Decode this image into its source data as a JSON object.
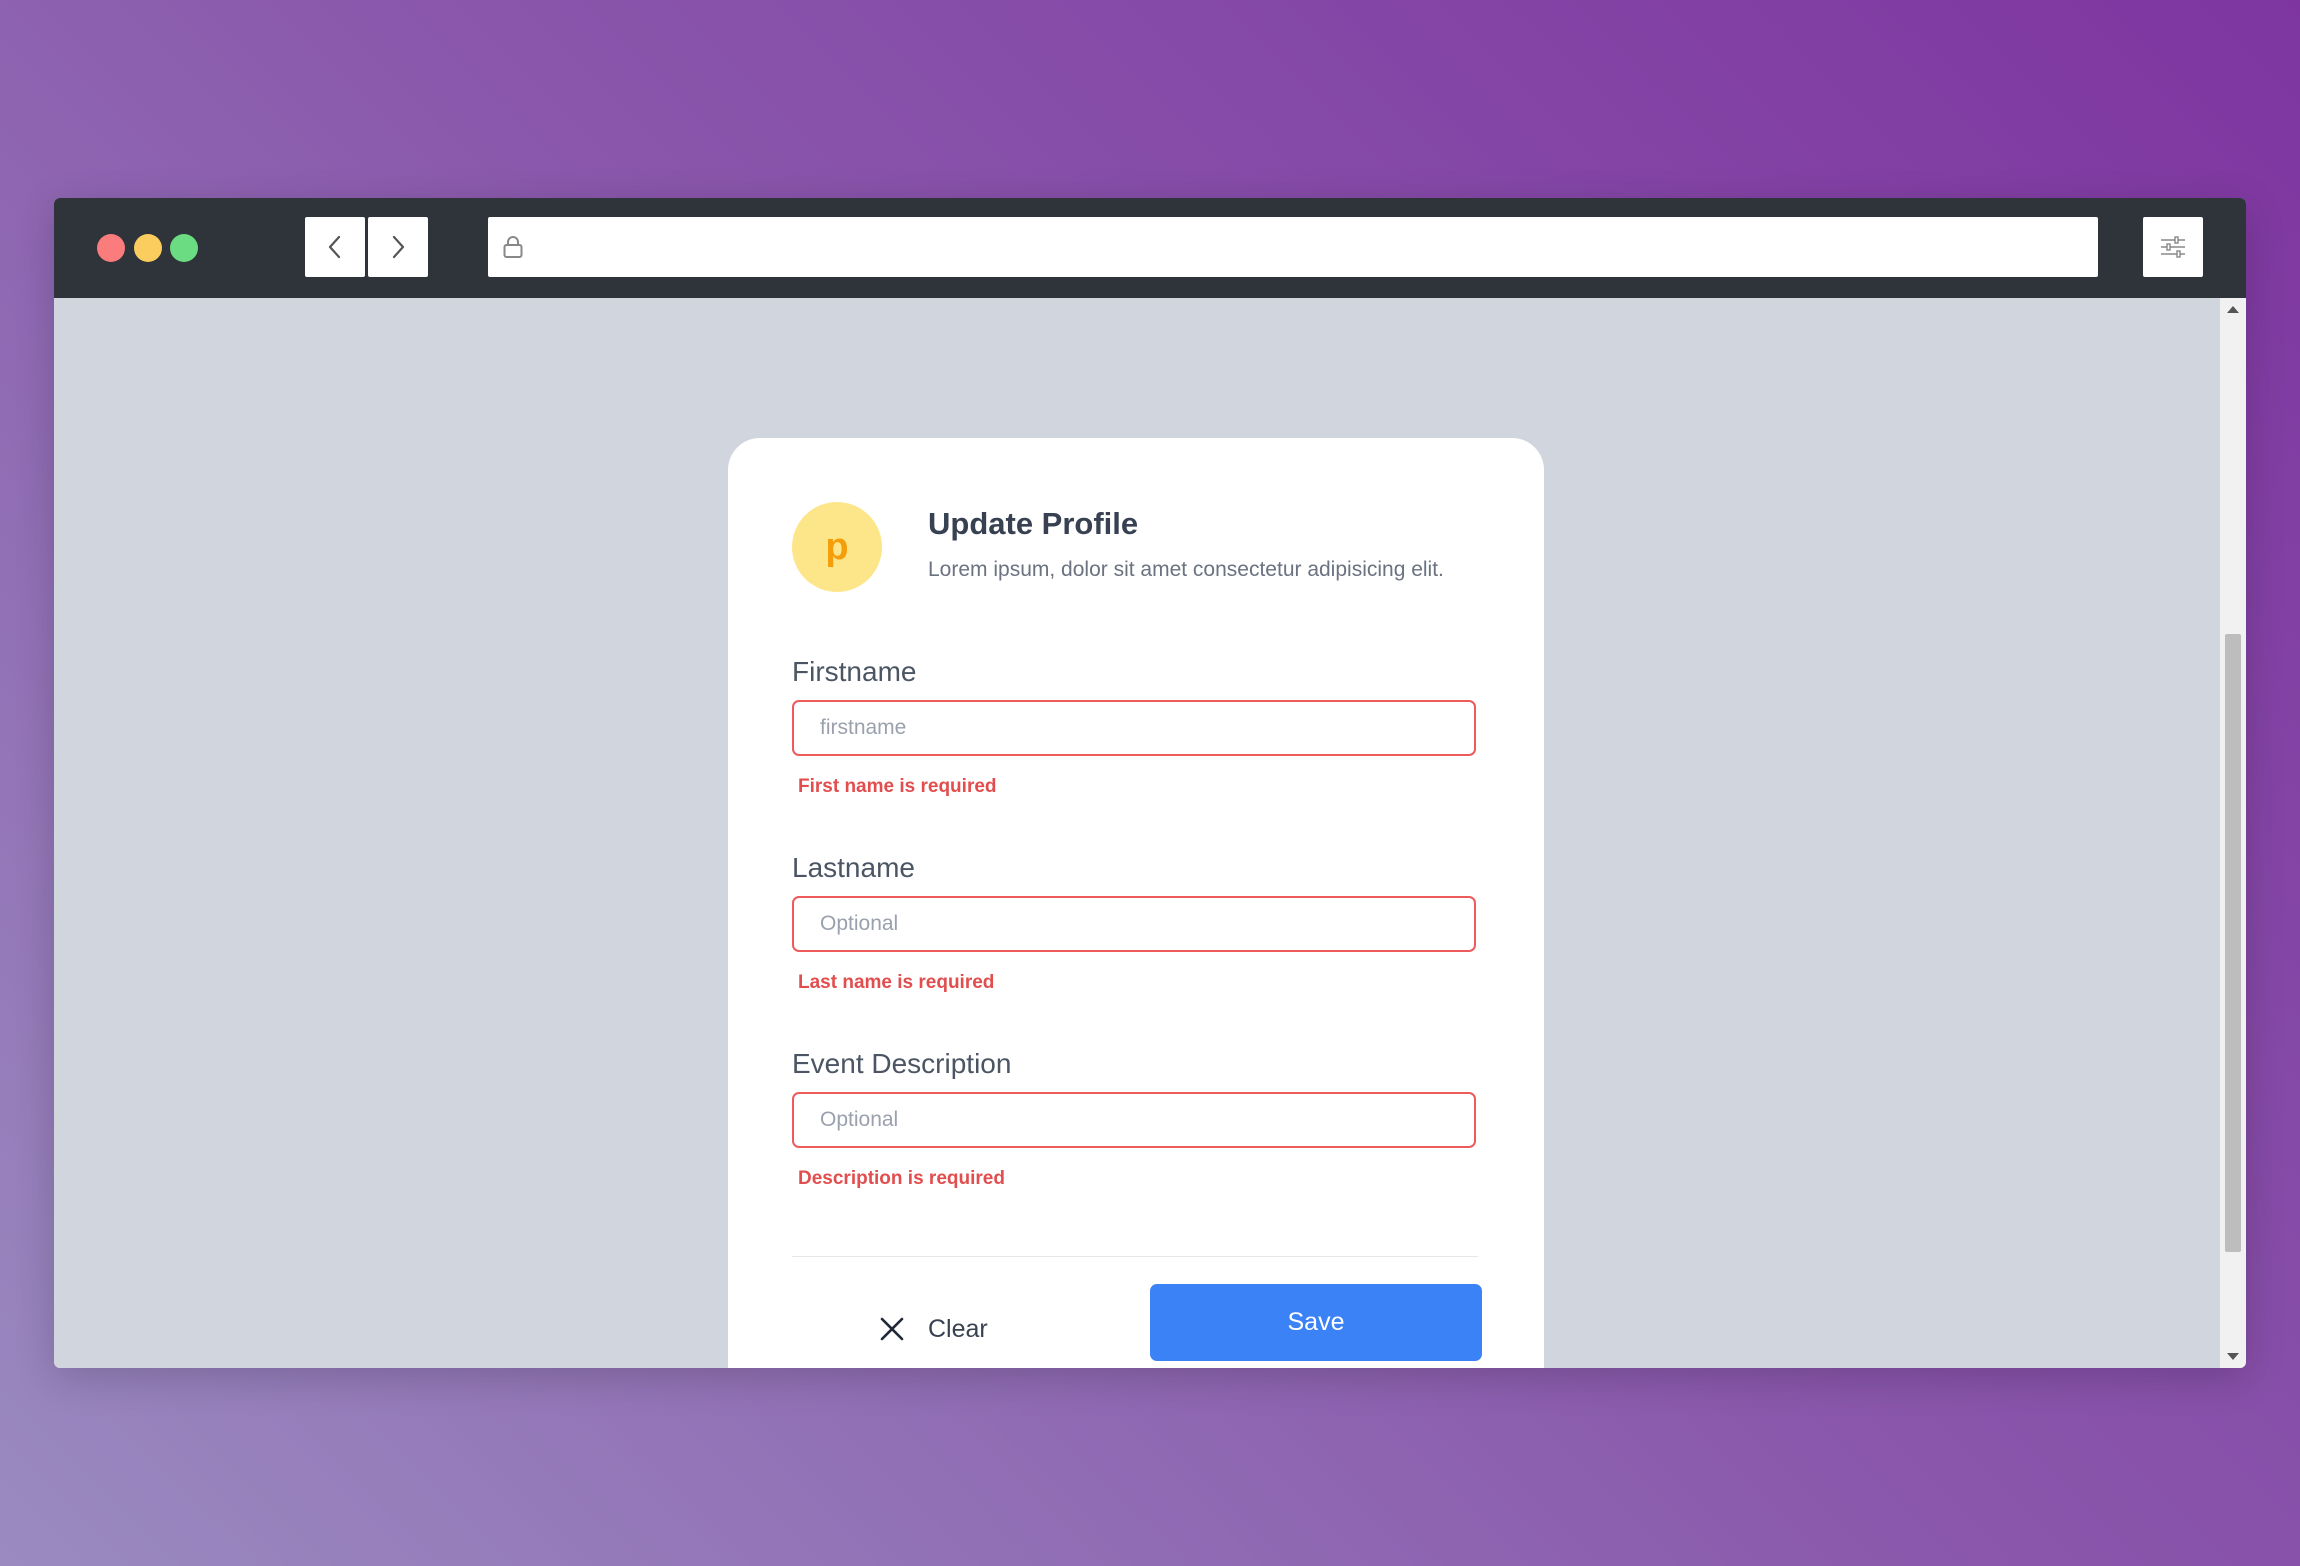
{
  "browser": {
    "dots": [
      "close",
      "minimize",
      "maximize"
    ],
    "back_icon": "chevron-left-icon",
    "forward_icon": "chevron-right-icon",
    "lock_icon": "lock-icon",
    "menu_icon": "sliders-icon",
    "url": ""
  },
  "profile": {
    "avatar_letter": "p",
    "title": "Update Profile",
    "subtitle": "Lorem ipsum, dolor sit amet consectetur adipisicing elit."
  },
  "form": {
    "firstname": {
      "label": "Firstname",
      "placeholder": "firstname",
      "value": "",
      "error": "First name is required"
    },
    "lastname": {
      "label": "Lastname",
      "placeholder": "Optional",
      "value": "",
      "error": "Last name is required"
    },
    "description": {
      "label": "Event Description",
      "placeholder": "Optional",
      "value": "",
      "error": "Description is required"
    }
  },
  "actions": {
    "clear_label": "Clear",
    "clear_icon": "close-icon",
    "save_label": "Save"
  },
  "colors": {
    "accent": "#3b82f6",
    "error": "#e24e4e",
    "avatar_bg": "#fde68a",
    "avatar_text": "#f59e0b"
  }
}
